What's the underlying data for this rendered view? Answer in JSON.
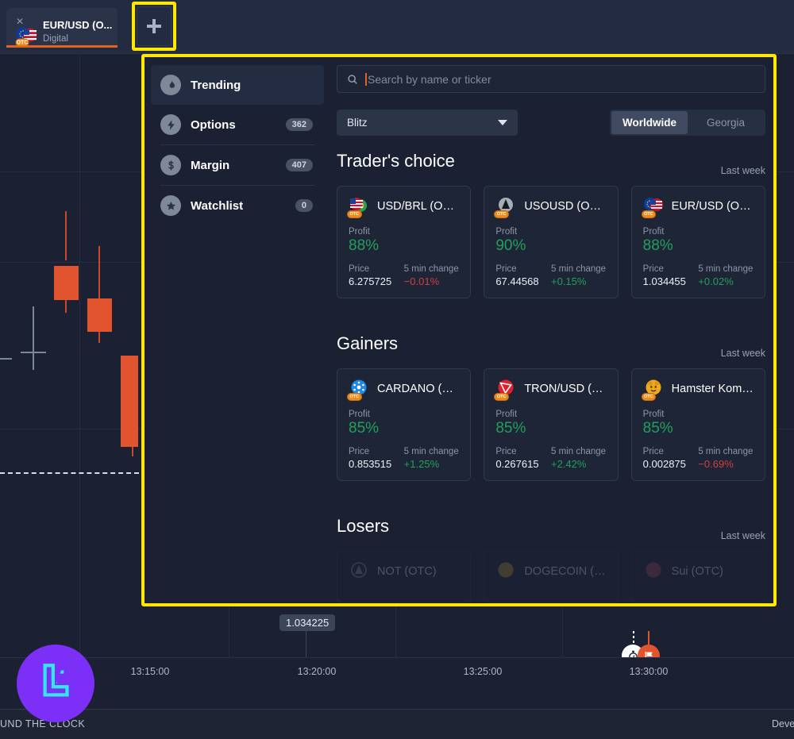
{
  "tab": {
    "title": "EUR/USD (O...",
    "subtitle": "Digital",
    "close_icon": "close-icon",
    "icon": "eurusd-otc-flag-icon"
  },
  "add_tab": {
    "icon": "plus-icon",
    "label": "+"
  },
  "panel": {
    "sidebar": {
      "items": [
        {
          "label": "Trending",
          "badge": "",
          "icon": "flame-icon",
          "active": true
        },
        {
          "label": "Options",
          "badge": "362",
          "icon": "lightning-icon",
          "active": false
        },
        {
          "label": "Margin",
          "badge": "407",
          "icon": "dollar-icon",
          "active": false
        },
        {
          "label": "Watchlist",
          "badge": "0",
          "icon": "star-icon",
          "active": false
        }
      ]
    },
    "search": {
      "placeholder": "Search by name or ticker",
      "value": "",
      "icon": "search-icon"
    },
    "filter": {
      "selected": "Blitz",
      "caret_icon": "chevron-down-icon"
    },
    "region_toggle": {
      "options": [
        "Worldwide",
        "Georgia"
      ],
      "selected": "Worldwide"
    },
    "sections": [
      {
        "id": "traders-choice",
        "title": "Trader's choice",
        "period": "Last week",
        "cards": [
          {
            "name": "USD/BRL (OTC)",
            "icon": "usd-brl-otc-icon",
            "profit_label": "Profit",
            "profit": "88%",
            "price_label": "Price",
            "price": "6.275725",
            "change_label": "5 min change",
            "change": "−0.01%",
            "direction": "down"
          },
          {
            "name": "USOUSD (OTC)",
            "icon": "usousd-otc-icon",
            "profit_label": "Profit",
            "profit": "90%",
            "price_label": "Price",
            "price": "67.44568",
            "change_label": "5 min change",
            "change": "+0.15%",
            "direction": "up"
          },
          {
            "name": "EUR/USD (OTC)",
            "icon": "eur-usd-otc-icon",
            "profit_label": "Profit",
            "profit": "88%",
            "price_label": "Price",
            "price": "1.034455",
            "change_label": "5 min change",
            "change": "+0.02%",
            "direction": "up"
          }
        ]
      },
      {
        "id": "gainers",
        "title": "Gainers",
        "period": "Last week",
        "cards": [
          {
            "name": "CARDANO (OTC)",
            "icon": "cardano-otc-icon",
            "profit_label": "Profit",
            "profit": "85%",
            "price_label": "Price",
            "price": "0.853515",
            "change_label": "5 min change",
            "change": "+1.25%",
            "direction": "up"
          },
          {
            "name": "TRON/USD (O...",
            "icon": "tron-usd-otc-icon",
            "profit_label": "Profit",
            "profit": "85%",
            "price_label": "Price",
            "price": "0.267615",
            "change_label": "5 min change",
            "change": "+2.42%",
            "direction": "up"
          },
          {
            "name": "Hamster Komb...",
            "icon": "hamster-kombat-otc-icon",
            "profit_label": "Profit",
            "profit": "85%",
            "price_label": "Price",
            "price": "0.002875",
            "change_label": "5 min change",
            "change": "−0.69%",
            "direction": "down"
          }
        ]
      },
      {
        "id": "losers",
        "title": "Losers",
        "period": "Last week",
        "cards": [
          {
            "name": "NOT (OTC)",
            "icon": "not-otc-icon",
            "profit_label": "",
            "profit": "",
            "price_label": "",
            "price": "",
            "change_label": "",
            "change": "",
            "direction": ""
          },
          {
            "name": "DOGECOIN (O...",
            "icon": "dogecoin-otc-icon",
            "profit_label": "",
            "profit": "",
            "price_label": "",
            "price": "",
            "change_label": "",
            "change": "",
            "direction": ""
          },
          {
            "name": "Sui (OTC)",
            "icon": "sui-otc-icon",
            "profit_label": "",
            "profit": "",
            "price_label": "",
            "price": "",
            "change_label": "",
            "change": "",
            "direction": ""
          }
        ]
      }
    ]
  },
  "chart": {
    "price_tag": "1.034225",
    "time_labels": [
      "13:15:00",
      "13:20:00",
      "13:25:00",
      "13:30:00"
    ],
    "markers": {
      "clock_icon": "stopwatch-icon",
      "flag_icon": "flag-icon"
    }
  },
  "footer": {
    "logo_icon": "brand-logo-icon",
    "left_text": "UND THE CLOCK",
    "right_text": "Devel"
  },
  "colors": {
    "accent_orange": "#e2631f",
    "up_green": "#21a05a",
    "down_red": "#cf4040",
    "highlight_yellow": "#ffe800",
    "panel_bg": "#1b2133",
    "card_bg": "#1e2536"
  }
}
